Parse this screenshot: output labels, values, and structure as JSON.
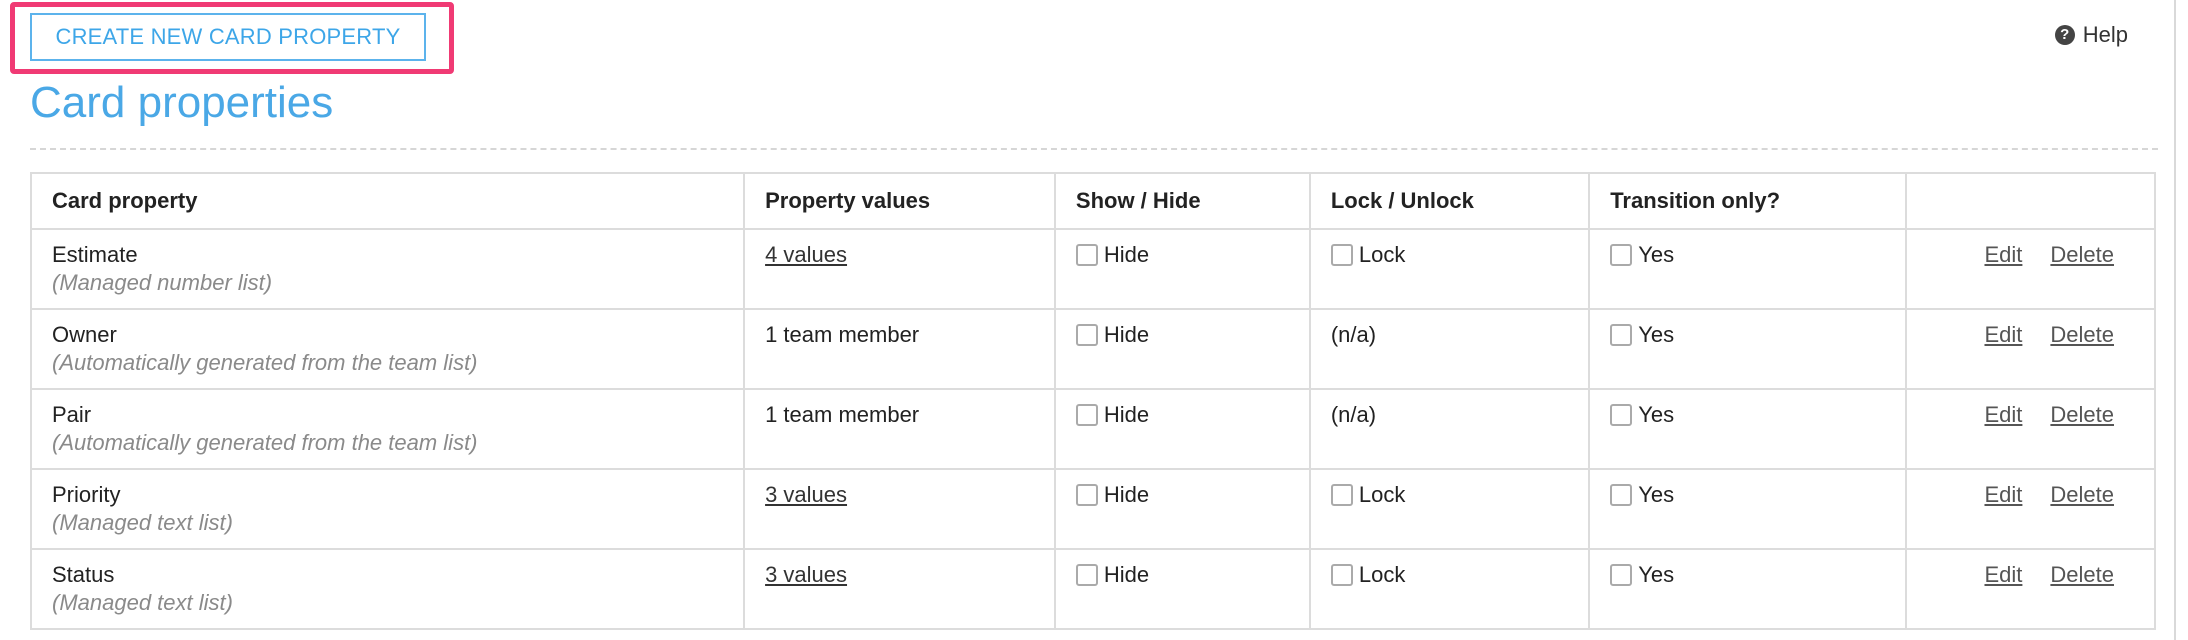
{
  "toolbar": {
    "create_label": "CREATE NEW CARD PROPERTY",
    "help_label": "Help",
    "help_icon": "question-circle-icon"
  },
  "page": {
    "title": "Card properties"
  },
  "colors": {
    "accent": "#3da6e8",
    "highlight": "#f03a74"
  },
  "table": {
    "headers": [
      "Card property",
      "Property values",
      "Show / Hide",
      "Lock / Unlock",
      "Transition only?",
      ""
    ],
    "rows": [
      {
        "name": "Estimate",
        "desc": "(Managed number list)",
        "values": "4 values",
        "values_link": true,
        "hide": "Hide",
        "lock": "Lock",
        "lock_na": false,
        "transition": "Yes",
        "edit": "Edit",
        "delete": "Delete"
      },
      {
        "name": "Owner",
        "desc": "(Automatically generated from the team list)",
        "values": "1 team member",
        "values_link": false,
        "hide": "Hide",
        "lock": "(n/a)",
        "lock_na": true,
        "transition": "Yes",
        "edit": "Edit",
        "delete": "Delete"
      },
      {
        "name": "Pair",
        "desc": "(Automatically generated from the team list)",
        "values": "1 team member",
        "values_link": false,
        "hide": "Hide",
        "lock": "(n/a)",
        "lock_na": true,
        "transition": "Yes",
        "edit": "Edit",
        "delete": "Delete"
      },
      {
        "name": "Priority",
        "desc": "(Managed text list)",
        "values": "3 values",
        "values_link": true,
        "hide": "Hide",
        "lock": "Lock",
        "lock_na": false,
        "transition": "Yes",
        "edit": "Edit",
        "delete": "Delete"
      },
      {
        "name": "Status",
        "desc": "(Managed text list)",
        "values": "3 values",
        "values_link": true,
        "hide": "Hide",
        "lock": "Lock",
        "lock_na": false,
        "transition": "Yes",
        "edit": "Edit",
        "delete": "Delete"
      }
    ]
  }
}
